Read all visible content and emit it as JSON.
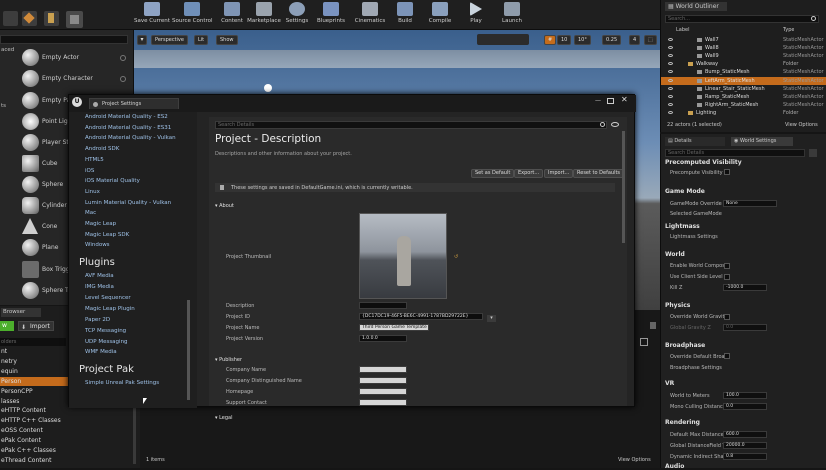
{
  "toolbar": {
    "buttons": [
      "Save Current",
      "Source Control",
      "Content",
      "Marketplace",
      "Settings",
      "Blueprints",
      "Cinematics",
      "Build",
      "Compile",
      "Play",
      "Launch"
    ]
  },
  "modes": {
    "side_labels": [
      "aced",
      "ts"
    ],
    "items": [
      "Empty Actor",
      "Empty Character",
      "Empty Pa",
      "Point Ligh",
      "Player St",
      "Cube",
      "Sphere",
      "Cylinder",
      "Cone",
      "Plane",
      "Box Trigg",
      "Sphere Tr"
    ]
  },
  "content_browser": {
    "tab": "Browser",
    "new_label": "w",
    "import_label": "Import",
    "folders_placeholder": "olders",
    "tree": [
      "nt",
      "netry",
      "equin",
      "Person",
      "PersonCPP",
      "lasses",
      "eHTTP Content",
      "eHTTP C++ Classes",
      "eOSS Content",
      "ePak Content",
      "ePak C++ Classes",
      "eThread Content"
    ],
    "selected_index": 3
  },
  "viewport": {
    "perspective": "Perspective",
    "lit": "Lit",
    "show": "Show",
    "grid_snap": "10",
    "rot_snap": "10°",
    "scale_snap": "0.25",
    "cam_speed": "4"
  },
  "bottom": {
    "items_count": "1 items",
    "view_options": "View Options"
  },
  "outliner": {
    "title": "World Outliner",
    "search_placeholder": "Search...",
    "col_label": "Label",
    "col_type": "Type",
    "rows": [
      {
        "label": "Wall7",
        "type": "StaticMeshActor"
      },
      {
        "label": "Wall8",
        "type": "StaticMeshActor"
      },
      {
        "label": "Wall9",
        "type": "StaticMeshActor"
      },
      {
        "label": "Walkway",
        "type": "Folder"
      },
      {
        "label": "Bump_StaticMesh",
        "type": "StaticMeshActor"
      },
      {
        "label": "LeftArm_StaticMesh",
        "type": "StaticMeshActor"
      },
      {
        "label": "Linear_Stair_StaticMesh",
        "type": "StaticMeshActor"
      },
      {
        "label": "Ramp_StaticMesh",
        "type": "StaticMeshActor"
      },
      {
        "label": "RightArm_StaticMesh",
        "type": "StaticMeshActor"
      },
      {
        "label": "Lighting",
        "type": "Folder"
      }
    ],
    "status": "22 actors (1 selected)",
    "view_options": "View Options"
  },
  "details": {
    "tab_details": "Details",
    "tab_world": "World Settings",
    "search_placeholder": "Search Details",
    "sections": {
      "precomputed": "Precomputed Visibility",
      "game_mode": "Game Mode",
      "lightmass": "Lightmass",
      "world": "World",
      "physics": "Physics",
      "broadphase": "Broadphase",
      "vr": "VR",
      "rendering": "Rendering",
      "audio": "Audio"
    },
    "props": {
      "precompute_visibility": "Precompute Visibility",
      "gamemode_override": "GameMode Override",
      "gamemode_value": "None",
      "selected_gamemode": "Selected GameMode",
      "lightmass_settings": "Lightmass Settings",
      "enable_world_composition": "Enable World Compos",
      "use_client_side": "Use Client Side Level",
      "kill_z": "Kill Z",
      "kill_z_value": "-1000.0",
      "override_world_gravity": "Override World Gravity",
      "global_gravity_z": "Global Gravity Z",
      "global_gravity_value": "0.0",
      "override_default_broadphase": "Override Default Broa",
      "broadphase_settings": "Broadphase Settings",
      "world_to_meters": "World to Meters",
      "world_to_meters_value": "100.0",
      "mono_culling": "Mono Culling Distance",
      "mono_culling_value": "0.0",
      "default_max_distance": "Default Max Distance",
      "default_max_distance_value": "600.0",
      "global_distance_field": "Global DistanceField V",
      "global_distance_field_value": "20000.0",
      "dynamic_indirect": "Dynamic Indirect Sha",
      "dynamic_indirect_value": "0.8"
    }
  },
  "project_settings": {
    "tab_title": "Project Settings",
    "nav_items": [
      "Android Material Quality - ES2",
      "Android Material Quality - ES31",
      "Android Material Quality - Vulkan",
      "Android SDK",
      "HTML5",
      "iOS",
      "iOS Material Quality",
      "Linux",
      "Lumin Material Quality - Vulkan",
      "Mac",
      "Magic Leap",
      "Magic Leap SDK",
      "Windows"
    ],
    "plugins_header": "Plugins",
    "plugin_items": [
      "AVF Media",
      "IMG Media",
      "Level Sequencer",
      "Magic Leap Plugin",
      "Paper 2D",
      "TCP Messaging",
      "UDP Messaging",
      "WMF Media"
    ],
    "project_pak_header": "Project Pak",
    "project_pak_items": [
      "Simple Unreal Pak Settings"
    ],
    "search_placeholder": "Search Details",
    "heading": "Project - Description",
    "subheading": "Descriptions and other information about your project.",
    "buttons": [
      "Set as Default",
      "Export...",
      "Import...",
      "Reset to Defaults"
    ],
    "notice": "These settings are saved in DefaultGame.ini, which is currently writable.",
    "about_section": "About",
    "thumbnail_label": "Project Thumbnail",
    "fields": [
      {
        "label": "Description",
        "value": ""
      },
      {
        "label": "Project ID",
        "value": "{DC17DC19-46F5-BE6C-4991-1787BD29722E}"
      },
      {
        "label": "Project Name",
        "value": "Third Person Game Template"
      },
      {
        "label": "Project Version",
        "value": "1.0.0.0"
      }
    ],
    "publisher_section": "Publisher",
    "publisher_fields": [
      "Company Name",
      "Company Distinguished Name",
      "Homepage",
      "Support Contact"
    ],
    "legal_section": "Legal"
  }
}
